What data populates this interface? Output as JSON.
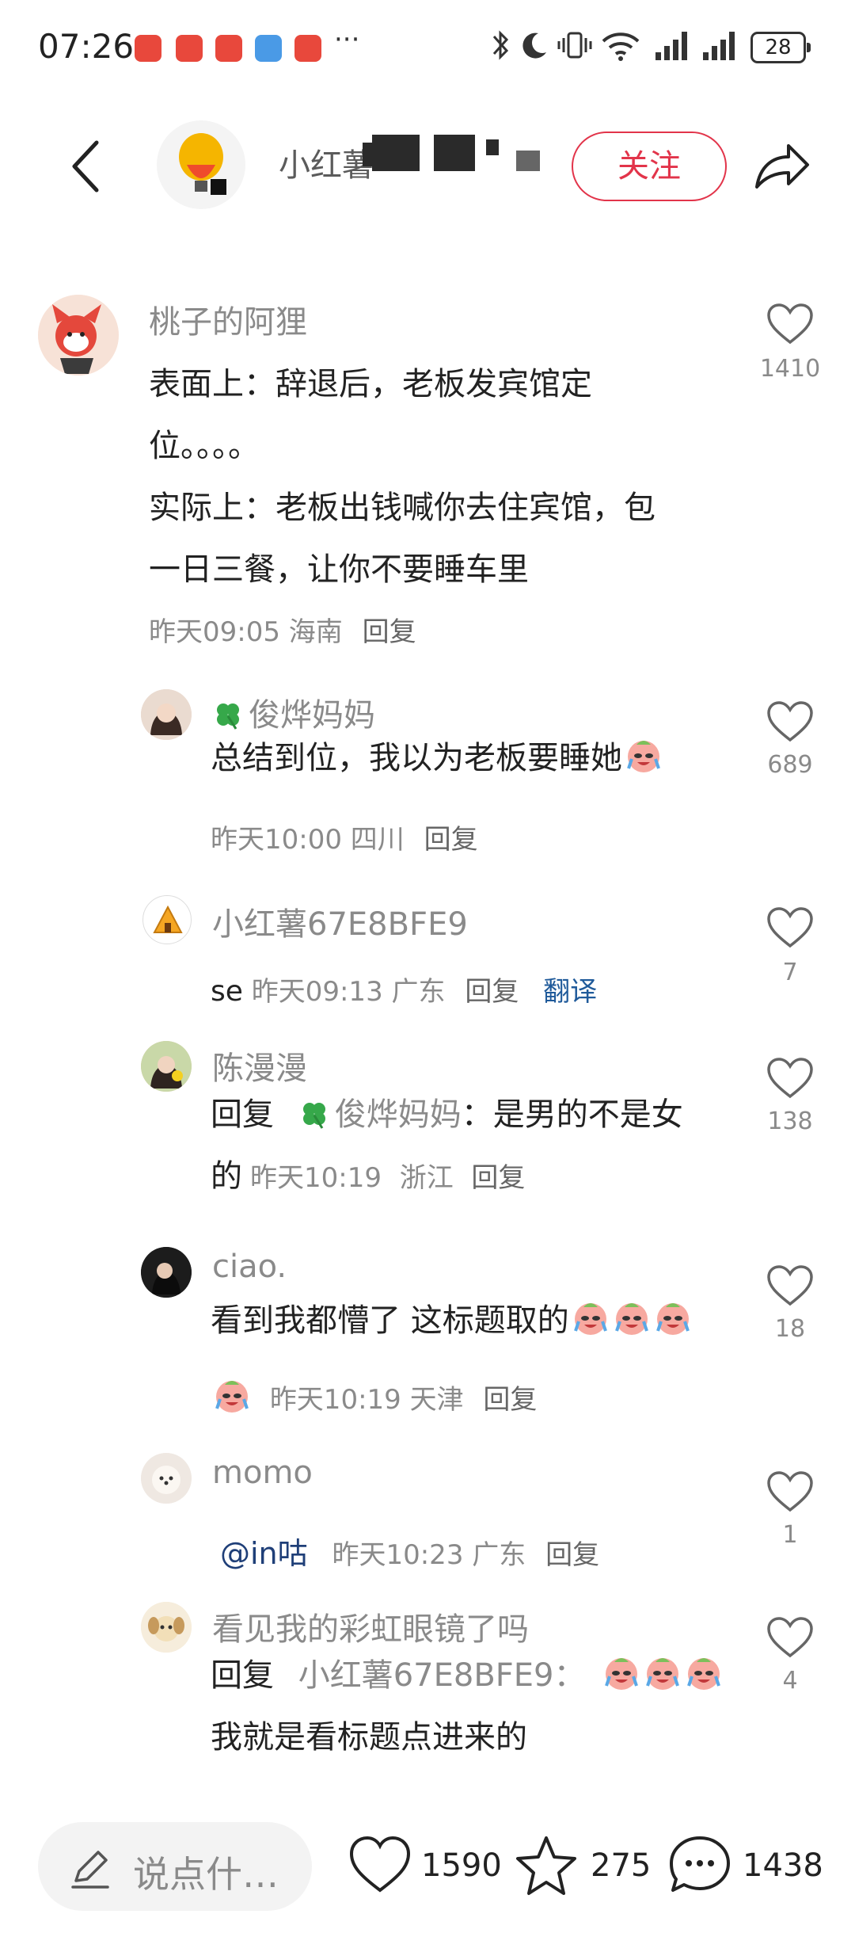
{
  "status_bar": {
    "time": "07:26",
    "battery": "28",
    "icons": [
      "missed-call-icon",
      "huawei-app-icon",
      "huawei-app-icon",
      "app-6-icon",
      "huawei-app-icon",
      "bluetooth-icon",
      "moon-icon",
      "vibrate-icon",
      "wifi-icon",
      "signal-icon",
      "signal-icon",
      "battery-icon"
    ]
  },
  "header": {
    "author_visible_text": "小红薯",
    "follow_label": "关注"
  },
  "comments": [
    {
      "name": "桃子的阿狸",
      "text_lines": [
        "表面上：辞退后，老板发宾馆定",
        "位。。。。",
        "实际上：老板出钱喊你去住宾馆，包",
        "一日三餐，让你不要睡车里"
      ],
      "time": "昨天09:05",
      "location": "海南",
      "reply": "回复",
      "likes": "1410"
    },
    {
      "name": "俊烨妈妈",
      "text": "总结到位，我以为老板要睡她",
      "time": "昨天10:00",
      "location": "四川",
      "reply": "回复",
      "likes": "689"
    },
    {
      "name": "小红薯67E8BFE9",
      "text": "se",
      "time": "昨天09:13",
      "location": "广东",
      "reply": "回复",
      "translate": "翻译",
      "likes": "7"
    },
    {
      "name": "陈漫漫",
      "reply_prefix": "回复",
      "reply_to": "俊烨妈妈",
      "text_part1": "：是男的不是女",
      "text_part2": "的",
      "time": "昨天10:19",
      "location": "浙江",
      "reply": "回复",
      "likes": "138"
    },
    {
      "name": "ciao.",
      "text": "看到我都懵了 这标题取的",
      "time": "昨天10:19",
      "location": "天津",
      "reply": "回复",
      "likes": "18"
    },
    {
      "name": "momo",
      "mention": "@in咕",
      "time": "昨天10:23",
      "location": "广东",
      "reply": "回复",
      "likes": "1"
    },
    {
      "name": "看见我的彩虹眼镜了吗",
      "reply_prefix": "回复",
      "reply_to": "小红薯67E8BFE9：",
      "text": "我就是看标题点进来的",
      "likes": "4"
    }
  ],
  "bottom_bar": {
    "input_placeholder": "说点什…",
    "like_count": "1590",
    "star_count": "275",
    "comment_count": "1438"
  },
  "colors": {
    "accent_red": "#e2344a",
    "mention_blue": "#1f3f78",
    "secondary_text": "#8a8a8a"
  }
}
